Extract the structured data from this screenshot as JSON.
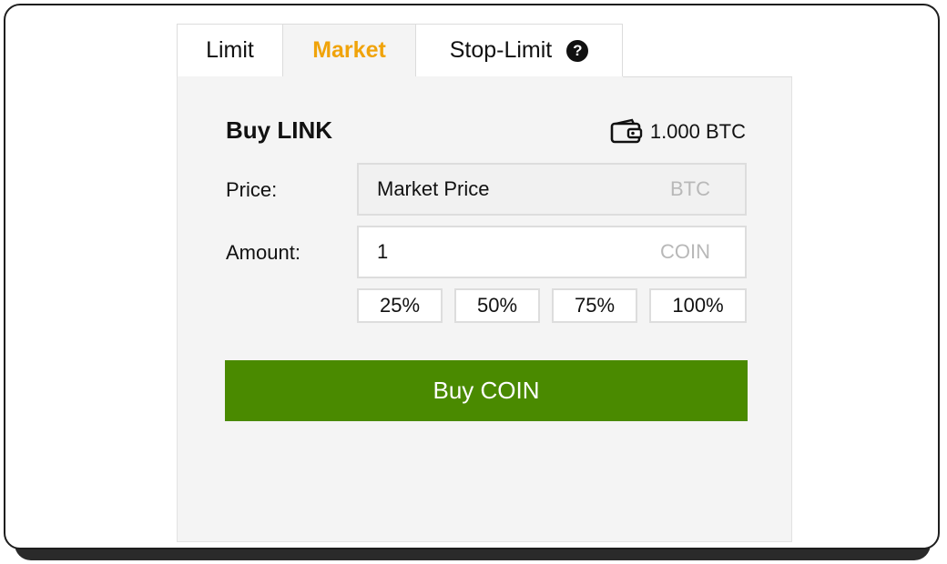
{
  "tabs": [
    {
      "label": "Limit"
    },
    {
      "label": "Market"
    },
    {
      "label": "Stop-Limit"
    }
  ],
  "active_tab": "Market",
  "help_icon": "?",
  "form": {
    "title": "Buy LINK",
    "balance": "1.000 BTC",
    "wallet_icon": "wallet-icon",
    "price": {
      "label": "Price:",
      "value": "Market Price",
      "unit": "BTC"
    },
    "amount": {
      "label": "Amount:",
      "value": "1",
      "unit": "COIN"
    },
    "percentages": [
      "25%",
      "50%",
      "75%",
      "100%"
    ],
    "submit_label": "Buy COIN"
  },
  "colors": {
    "accent": "#f0a30a",
    "buy_button": "#4a8a00",
    "panel_bg": "#f4f4f4"
  }
}
